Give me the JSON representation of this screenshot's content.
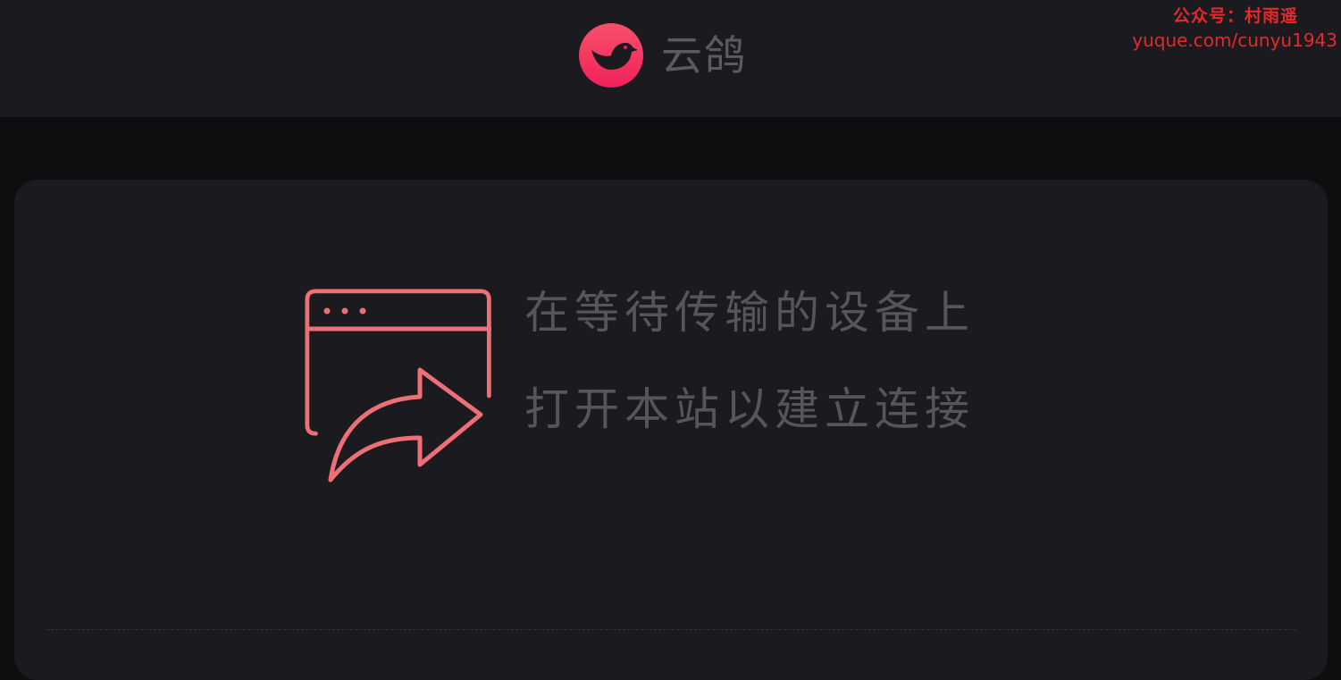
{
  "header": {
    "app_name": "云鸽",
    "logo_icon": "pigeon-logo-icon",
    "accent_color": "#f5335c"
  },
  "watermark": {
    "line1": "公众号：村雨遥",
    "line2": "yuque.com/cunyu1943"
  },
  "main": {
    "icon": "browser-share-icon",
    "icon_color": "#ef6f76",
    "message_line1": "在等待传输的设备上",
    "message_line2": "打开本站以建立连接"
  }
}
